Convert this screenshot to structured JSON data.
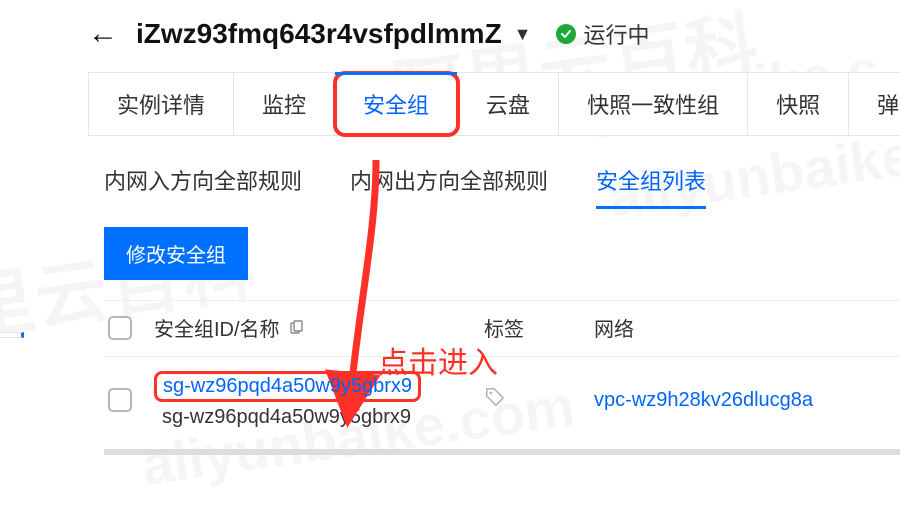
{
  "header": {
    "instance_name": "iZwz93fmq643r4vsfpdlmmZ",
    "status_label": "运行中"
  },
  "tabs": [
    {
      "label": "实例详情",
      "active": false
    },
    {
      "label": "监控",
      "active": false
    },
    {
      "label": "安全组",
      "active": true
    },
    {
      "label": "云盘",
      "active": false
    },
    {
      "label": "快照一致性组",
      "active": false
    },
    {
      "label": "快照",
      "active": false
    },
    {
      "label": "弹性",
      "active": false
    }
  ],
  "subtabs": [
    {
      "label": "内网入方向全部规则",
      "active": false
    },
    {
      "label": "内网出方向全部规则",
      "active": false
    },
    {
      "label": "安全组列表",
      "active": true
    }
  ],
  "buttons": {
    "modify_sg": "修改安全组"
  },
  "table": {
    "headers": {
      "id": "安全组ID/名称",
      "tag": "标签",
      "network": "网络"
    },
    "row": {
      "id_link": "sg-wz96pqd4a50w9y5gbrx9",
      "id_text": "sg-wz96pqd4a50w9y5gbrx9",
      "vpc": "vpc-wz9h28kv26dlucg8a"
    }
  },
  "annotations": {
    "click_enter": "点击进入"
  }
}
